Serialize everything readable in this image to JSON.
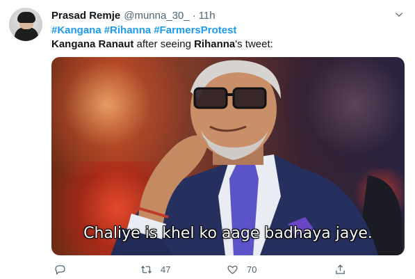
{
  "tweet": {
    "author_name": "Prasad Remje",
    "handle": "@munna_30_",
    "separator": "·",
    "time": "11h",
    "hashtags": [
      "#Kangana",
      "#Rihanna",
      "#FarmersProtest"
    ],
    "text_parts": [
      "Kangana Ranaut",
      " after seeing ",
      "Rihanna",
      "'s tweet:"
    ],
    "media_caption": "Chaliye is khel ko aage badhaya jaye.",
    "retweet_count": "47",
    "like_count": "70"
  },
  "icons": {
    "reply": "comment-icon",
    "retweet": "retweet-icon",
    "like": "heart-icon",
    "share": "share-icon",
    "more": "chevron-down-icon"
  },
  "colors": {
    "link": "#1d9bf0",
    "muted": "#536471",
    "text": "#0f1419"
  }
}
